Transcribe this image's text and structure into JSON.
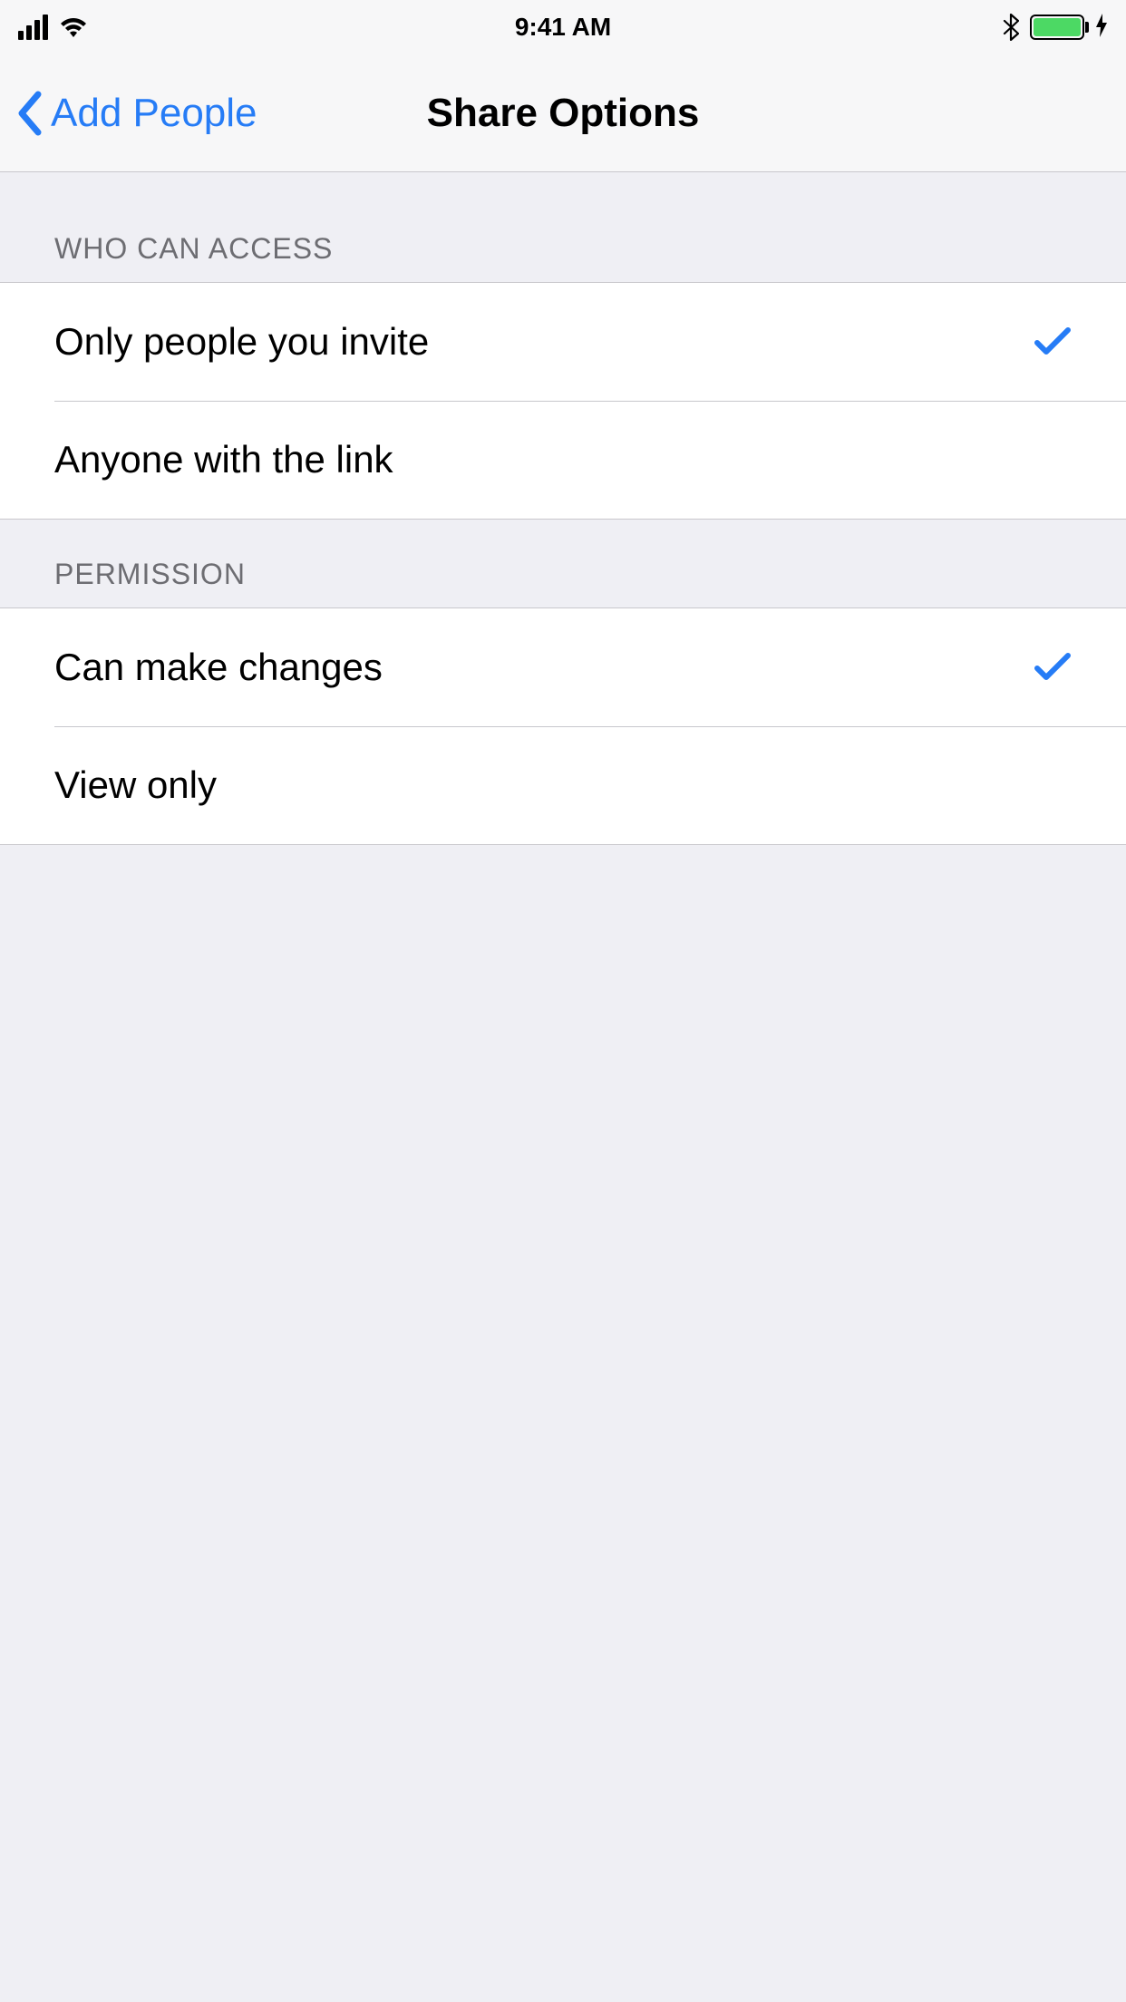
{
  "status_bar": {
    "time": "9:41 AM"
  },
  "nav": {
    "back_label": "Add People",
    "title": "Share Options"
  },
  "sections": {
    "access": {
      "header": "WHO CAN ACCESS",
      "rows": [
        {
          "label": "Only people you invite",
          "selected": true
        },
        {
          "label": "Anyone with the link",
          "selected": false
        }
      ]
    },
    "permission": {
      "header": "PERMISSION",
      "rows": [
        {
          "label": "Can make changes",
          "selected": true
        },
        {
          "label": "View only",
          "selected": false
        }
      ]
    }
  },
  "colors": {
    "accent": "#267cf6",
    "background": "#efeff4",
    "battery_fill": "#4cd964"
  }
}
